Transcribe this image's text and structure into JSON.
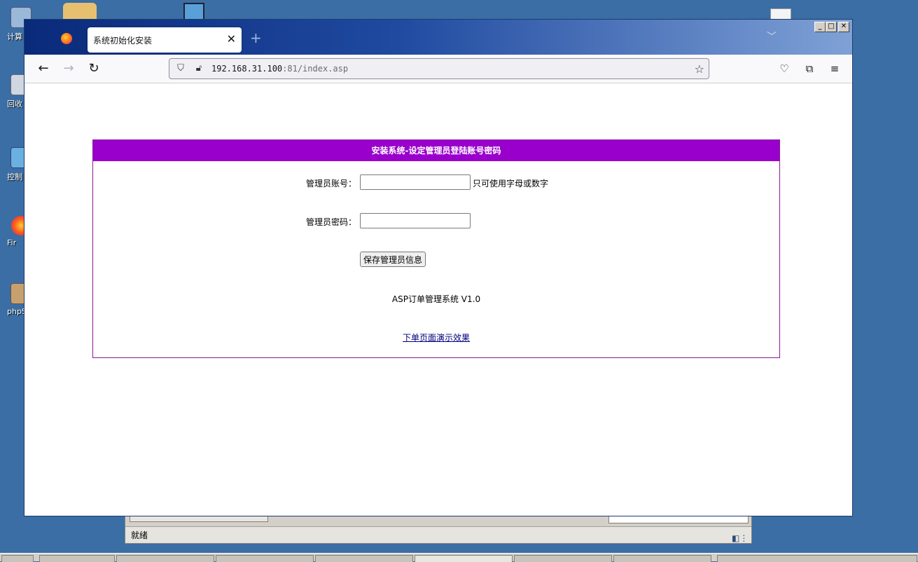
{
  "desktop": {
    "icons": [
      {
        "label": "计算"
      },
      {
        "label": "回收"
      },
      {
        "label": "控制"
      },
      {
        "label": "Fir"
      },
      {
        "label": "phpS"
      }
    ]
  },
  "background_window": {
    "status_text": "就绪"
  },
  "browser": {
    "tab": {
      "title": "系统初始化安装",
      "close_glyph": "✕"
    },
    "newtab_glyph": "+",
    "url": {
      "host": "192.168.31.100",
      "rest": ":81/index.asp"
    },
    "window_controls": {
      "minimize": "_",
      "maximize": "□",
      "close": "✕"
    }
  },
  "page": {
    "header": "安装系统-设定管理员登陆账号密码",
    "account_label": "管理员账号：",
    "account_value": "",
    "account_hint": "只可使用字母或数字",
    "password_label": "管理员密码：",
    "password_value": "",
    "save_button": "保存管理员信息",
    "version": "ASP订单管理系统 V1.0",
    "demo_link": "下单页面演示效果"
  },
  "colors": {
    "header_bg": "#9900cc",
    "panel_border": "#8b1a9a",
    "desktop_bg": "#3a6ea5"
  }
}
